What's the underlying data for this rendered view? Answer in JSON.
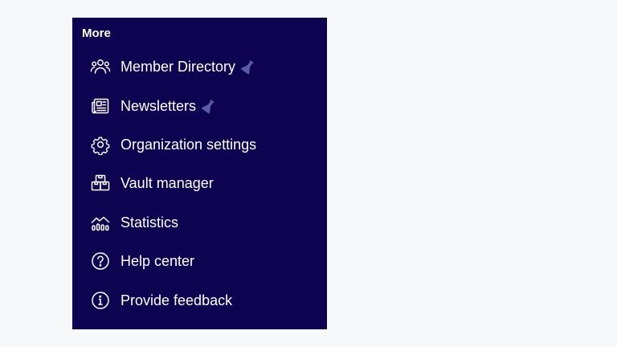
{
  "panel": {
    "title": "More",
    "background": "#0e0350",
    "items": [
      {
        "label": "Member Directory",
        "icon": "people-icon",
        "badge_icon": "beta-flask-icon"
      },
      {
        "label": "Newsletters",
        "icon": "newspaper-icon",
        "badge_icon": "beta-flask-icon"
      },
      {
        "label": "Organization settings",
        "icon": "gear-icon"
      },
      {
        "label": "Vault manager",
        "icon": "vault-boxes-icon"
      },
      {
        "label": "Statistics",
        "icon": "chart-icon"
      },
      {
        "label": "Help center",
        "icon": "help-circle-icon"
      },
      {
        "label": "Provide feedback",
        "icon": "info-circle-icon"
      }
    ]
  },
  "colors": {
    "page_background": "#f7f8fa",
    "text": "#ffffff",
    "beta_badge": "#5b5aa8"
  }
}
